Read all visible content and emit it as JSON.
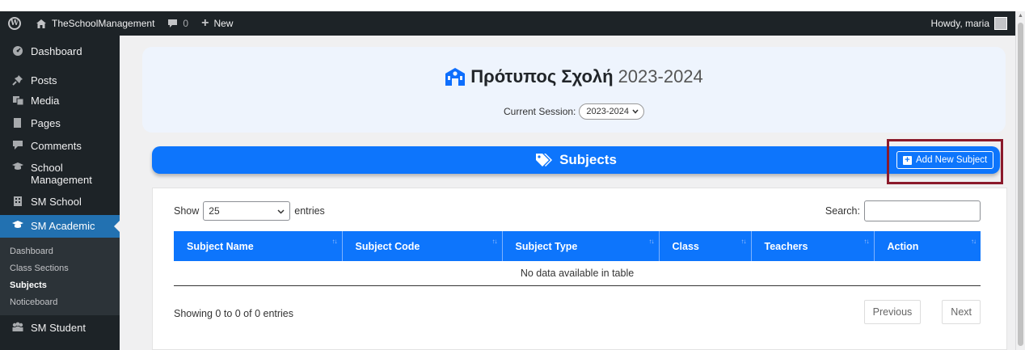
{
  "adminbar": {
    "site_name": "TheSchoolManagement",
    "comments_count": "0",
    "new_label": "New",
    "howdy": "Howdy, maria"
  },
  "sidebar": {
    "items": [
      {
        "label": "Dashboard",
        "icon": "dashboard-icon"
      },
      {
        "label": "Posts",
        "icon": "pushpin-icon"
      },
      {
        "label": "Media",
        "icon": "media-icon"
      },
      {
        "label": "Pages",
        "icon": "pages-icon"
      },
      {
        "label": "Comments",
        "icon": "comment-icon"
      },
      {
        "label": "School Management",
        "icon": "graduation-cap-icon"
      },
      {
        "label": "SM School",
        "icon": "building-icon"
      },
      {
        "label": "SM Academic",
        "icon": "graduation-cap-icon"
      },
      {
        "label": "SM Student",
        "icon": "students-icon"
      }
    ],
    "submenu": [
      {
        "label": "Dashboard"
      },
      {
        "label": "Class Sections"
      },
      {
        "label": "Subjects",
        "current": true
      },
      {
        "label": "Noticeboard"
      }
    ]
  },
  "header": {
    "school_name": "Πρότυπος Σχολή",
    "year": "2023-2024",
    "session_label": "Current Session:",
    "session_value": "2023-2024"
  },
  "subjects_bar": {
    "title": "Subjects",
    "add_button": "Add New Subject"
  },
  "table": {
    "show_label": "Show",
    "entries_value": "25",
    "entries_label": "entries",
    "search_label": "Search:",
    "columns": [
      "Subject Name",
      "Subject Code",
      "Subject Type",
      "Class",
      "Teachers",
      "Action"
    ],
    "empty_message": "No data available in table",
    "info": "Showing 0 to 0 of 0 entries",
    "prev_label": "Previous",
    "next_label": "Next"
  },
  "colors": {
    "admin_bg": "#1d2327",
    "accent_blue": "#0d75fc",
    "active_menu": "#2271b1",
    "highlight_box": "#8b1a2b",
    "header_card": "#eef4fd"
  }
}
